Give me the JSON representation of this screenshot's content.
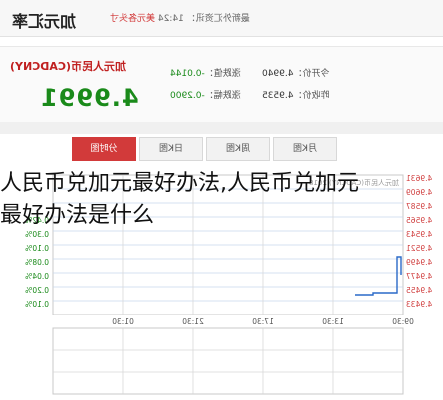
{
  "header": {
    "title": "加元汇率",
    "info_prefix": "最新外汇资讯：",
    "info_time": "14:24",
    "info_link": "美元各头寸"
  },
  "quote": {
    "pair": "加元人民币(CADCNY)",
    "price": "4.9991",
    "change_label": "涨跌值：",
    "change_value": "-0.0144",
    "change_pct_label": "涨跌幅：",
    "change_pct_value": "-0.2900",
    "open_label": "今开价：",
    "open_value": "4.9940",
    "prev_close_label": "昨收价：",
    "prev_close_value": "4.9535"
  },
  "tabs": [
    "分时图",
    "日K图",
    "周K图",
    "月K图"
  ],
  "chart_top": {
    "y_right": [
      "4.9631",
      "4.9609",
      "4.9587",
      "4.9565",
      "4.9543",
      "4.9521",
      "4.9499",
      "4.9477",
      "4.9455",
      "4.9433"
    ],
    "y_left": [
      "0.10%",
      "0.08%",
      "0.04%",
      "0.20%",
      "0.10%",
      "0.30%",
      "0.42%"
    ],
    "x_labels": [
      "09:30",
      "13:30",
      "17:30",
      "21:30",
      "01:30"
    ],
    "legend": "加元人民币(CADCNY) 2018"
  },
  "overlay": {
    "line1": "人民币兑加元最好办法,人民币兑加元",
    "line2": "最好办法是什么"
  }
}
